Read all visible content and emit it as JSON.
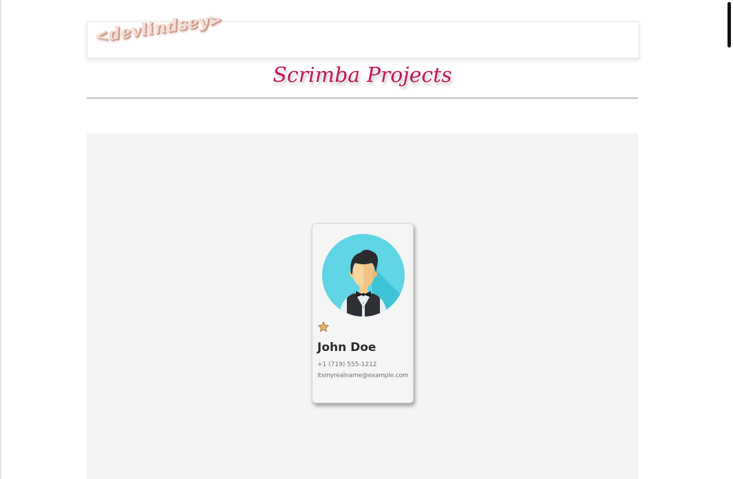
{
  "header": {
    "logo_text": "<devlindsey>"
  },
  "page": {
    "title": "Scrimba Projects"
  },
  "contact_card": {
    "avatar_icon": "waiter-avatar-icon",
    "favorite_icon": "star-icon",
    "favorite": true,
    "name": "John Doe",
    "phone": "+1 (719) 555-1212",
    "email": "itsmyrealname@example.com"
  },
  "colors": {
    "title": "#c2185b",
    "logo": "#f6ddd3",
    "stage_background": "#f4f4f4",
    "avatar_circle": "#5fd5e6",
    "star": "#e8b45a"
  }
}
